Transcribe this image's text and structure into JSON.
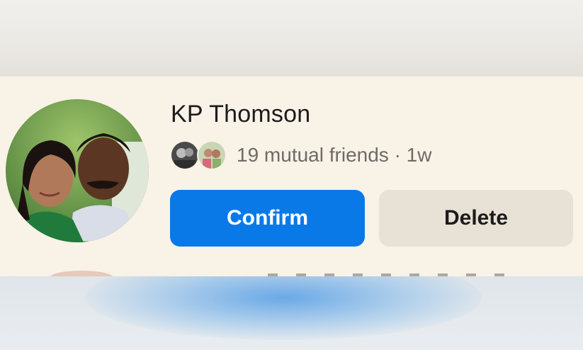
{
  "request": {
    "name": "KP Thomson",
    "mutual_friends": "19 mutual friends · 1w",
    "avatar_icon": "profile-photo-couple",
    "mutual_avatars": [
      "mutual-friend-avatar",
      "mutual-friend-avatar"
    ]
  },
  "actions": {
    "confirm_label": "Confirm",
    "delete_label": "Delete"
  },
  "colors": {
    "card_background": "#f9f2e7",
    "confirm_background": "#0a79e8",
    "delete_background": "#e8e1d5",
    "secondary_text": "#6d6b66"
  }
}
